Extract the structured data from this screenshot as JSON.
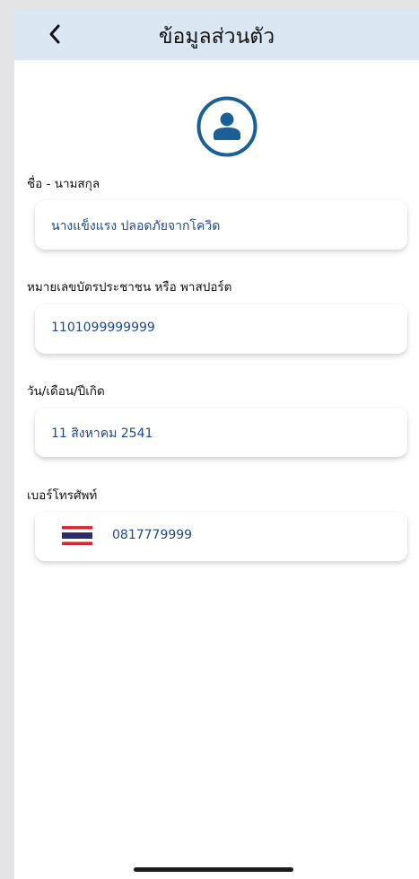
{
  "header": {
    "title": "ข้อมูลส่วนตัว",
    "back_icon": "chevron-left-icon"
  },
  "avatar": {
    "icon": "user-avatar-icon",
    "color": "#1a5f96"
  },
  "fields": {
    "name": {
      "label": "ชื่อ - นามสกุล",
      "value": "นางแข็งแรง ปลอดภัยจากโควิด"
    },
    "id_number": {
      "label": "หมายเลขบัตรประชาชน หรือ พาสปอร์ต",
      "value": "1101099999999"
    },
    "birthdate": {
      "label": "วัน/เดือน/ปีเกิด",
      "value": "11 สิงหาคม 2541"
    },
    "phone": {
      "label": "เบอร์โทรศัพท์",
      "country_flag": "thailand-flag-icon",
      "value": "0817779999"
    }
  },
  "colors": {
    "header_bg": "#dbe7f3",
    "value_text": "#1b4a8c",
    "page_bg": "#ffffff",
    "outer_bg": "#e4e4e6"
  }
}
